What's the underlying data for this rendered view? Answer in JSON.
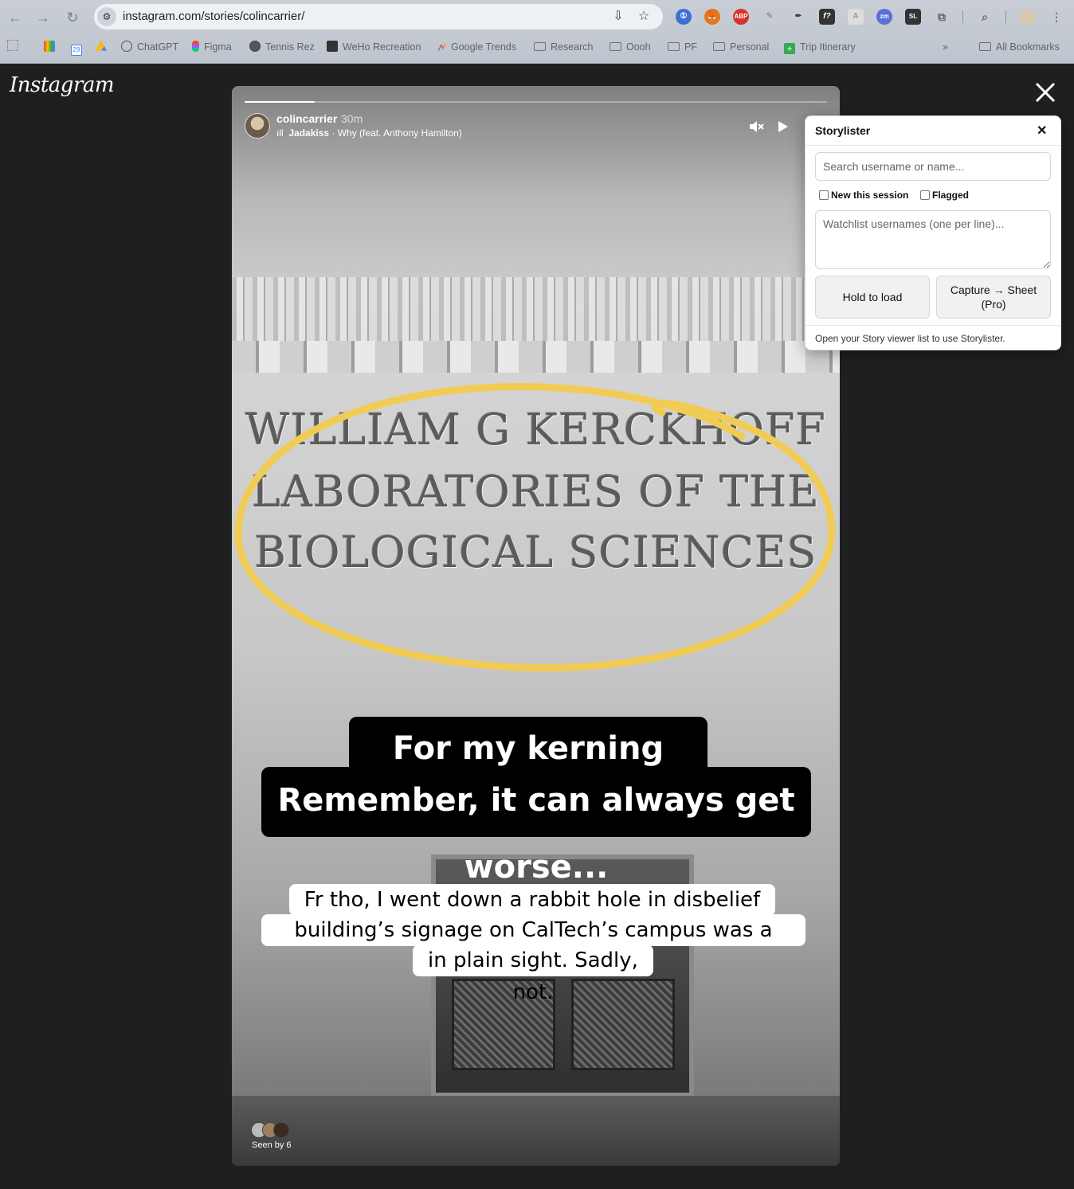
{
  "browser": {
    "url": "instagram.com/stories/colincarrier/",
    "bookmarks": [
      {
        "label": "",
        "icon": "gmail-icon"
      },
      {
        "label": "",
        "icon": "calendar-icon",
        "badge": "29"
      },
      {
        "label": "",
        "icon": "drive-icon"
      },
      {
        "label": "ChatGPT",
        "icon": "chatgpt-icon"
      },
      {
        "label": "Figma",
        "icon": "figma-icon"
      },
      {
        "label": "Tennis Rez",
        "icon": "globe-icon"
      },
      {
        "label": "WeHo Recreation",
        "icon": "weho-icon"
      },
      {
        "label": "Google Trends",
        "icon": "trends-icon"
      },
      {
        "label": "Research",
        "icon": "folder-icon"
      },
      {
        "label": "Oooh",
        "icon": "folder-icon"
      },
      {
        "label": "PF",
        "icon": "folder-icon"
      },
      {
        "label": "Personal",
        "icon": "folder-icon"
      },
      {
        "label": "Trip Itinerary",
        "icon": "plus-doc-icon"
      }
    ],
    "overflow": "»",
    "all_bookmarks": "All Bookmarks",
    "extensions": [
      "1password-icon",
      "metamask-icon",
      "adblock-icon",
      "eyedropper-icon",
      "font-icon",
      "zoom-icon",
      "storylister-icon",
      "puzzle-icon",
      "search-tab-icon",
      "profile-icon"
    ],
    "adblock_label": "ABP",
    "zoom_label": "zm",
    "storylister_label": "SL"
  },
  "instagram": {
    "logo": "Instagram",
    "story": {
      "username": "colincarrier",
      "time": "30m",
      "music_artist": "Jadakiss",
      "music_title": " · Why (feat. Anthony Hamilton)",
      "progress_fraction": 0.12,
      "inscription": [
        "WILLIAM G KERCKHOFF",
        "LABORATORIES OF THE",
        "BIOLOGICAL SCIENCES"
      ],
      "caption_main": [
        "For my kerning fanatics.",
        "Remember, it can always get worse..."
      ],
      "caption_secondary": [
        "Fr tho, I went down a rabbit hole in disbelief that this",
        "building’s signage on CalTech’s campus was a cypher hiding",
        "in plain sight.  Sadly, not."
      ],
      "seen_by": "Seen by 6",
      "annotation_color": "#f1cc55"
    }
  },
  "storylister": {
    "title": "Storylister",
    "close": "✕",
    "search_placeholder": "Search username or name...",
    "new_session": "New this session",
    "flagged": "Flagged",
    "watchlist_placeholder": "Watchlist usernames (one per line)...",
    "hold_button": "Hold to load",
    "capture_button": "Capture → Sheet (Pro)",
    "footer": "Open your Story viewer list to use Storylister."
  }
}
